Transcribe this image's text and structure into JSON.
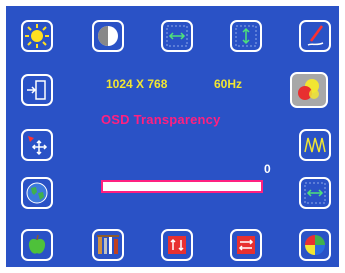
{
  "osd": {
    "resolution": "1024 X 768",
    "refresh_rate": "60Hz",
    "menu_title": "OSD Transparency",
    "value": "0",
    "level": 0
  },
  "icons": {
    "top_row": [
      "brightness-icon",
      "contrast-icon",
      "h-position-icon",
      "v-position-icon",
      "pen-edit-icon"
    ],
    "left_column": [
      "exit-icon",
      "osd-position-icon",
      "globe-language-icon"
    ],
    "right_column": [
      "color-circles-icon",
      "waveform-phase-icon",
      "h-size-icon"
    ],
    "bottom_row": [
      "apple-icon",
      "tools-icon",
      "flip-arrows-icon",
      "swap-arrows-icon",
      "color-pie-icon"
    ],
    "selected": "color-circles-icon"
  },
  "colors": {
    "background": "#2a52c6",
    "text_yellow": "#f2e632",
    "accent_pink": "#ff2080",
    "selected_bg": "#a8a8a8"
  }
}
